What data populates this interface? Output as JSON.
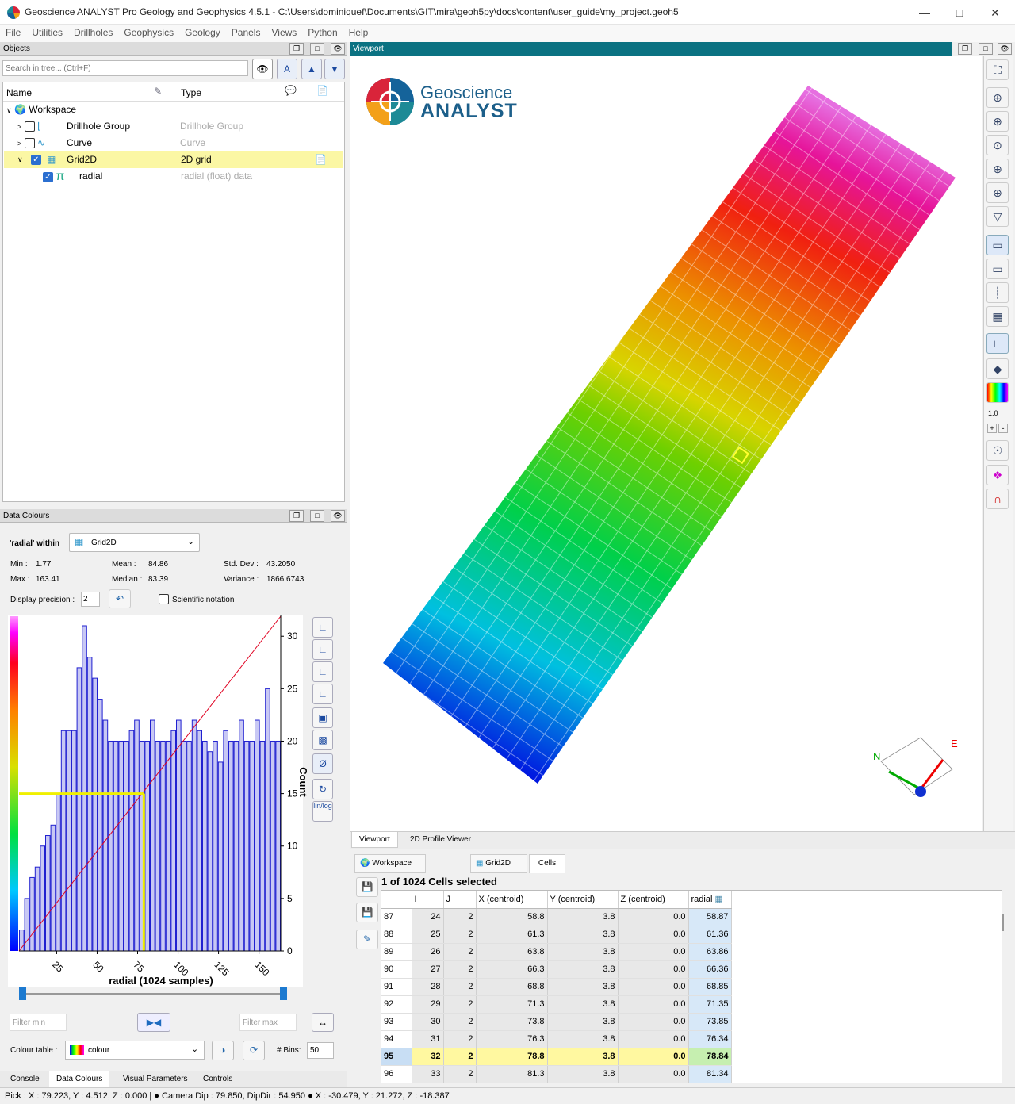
{
  "window": {
    "title": "Geoscience ANALYST Pro Geology and Geophysics 4.5.1 - C:\\Users\\dominiquef\\Documents\\GIT\\mira\\geoh5py\\docs\\content\\user_guide\\my_project.geoh5"
  },
  "menu": [
    "File",
    "Utilities",
    "Drillholes",
    "Geophysics",
    "Geology",
    "Panels",
    "Views",
    "Python",
    "Help"
  ],
  "objects_panel": {
    "header": "Objects",
    "search_placeholder": "Search in tree... (Ctrl+F)",
    "columns": {
      "name": "Name",
      "type": "Type"
    },
    "tree": [
      {
        "name": "Workspace",
        "type": ""
      },
      {
        "name": "Drillhole Group",
        "type": "Drillhole Group"
      },
      {
        "name": "Curve",
        "type": "Curve"
      },
      {
        "name": "Grid2D",
        "type": "2D grid"
      },
      {
        "name": "radial",
        "type": "radial (float) data"
      }
    ]
  },
  "viewport": {
    "header": "Viewport",
    "logo_line1": "Geoscience",
    "logo_line2": "ANALYST",
    "axis_n": "N",
    "axis_e": "E",
    "opacity_value": "1.0",
    "tabs": [
      "Viewport",
      "2D Profile Viewer"
    ]
  },
  "data_colours": {
    "header": "Data Colours",
    "within_label": "'radial' within",
    "within_value": "Grid2D",
    "stats": {
      "min_label": "Min :",
      "min": "1.77",
      "mean_label": "Mean :",
      "mean": "84.86",
      "std_label": "Std. Dev :",
      "std": "43.2050",
      "max_label": "Max :",
      "max": "163.41",
      "median_label": "Median :",
      "median": "83.39",
      "var_label": "Variance :",
      "var": "1866.6743"
    },
    "precision_label": "Display precision :",
    "precision_value": "2",
    "sci_label": "Scientific notation",
    "filter_min_placeholder": "Filter min",
    "filter_max_placeholder": "Filter max",
    "colour_table_label": "Colour table :",
    "colour_table_value": "colour",
    "bins_label": "# Bins:",
    "bins_value": "50",
    "log_btn": "lin/log"
  },
  "chart_data": {
    "type": "bar",
    "xlabel": "radial (1024 samples)",
    "ylabel": "Count",
    "xlim": [
      1.77,
      163.41
    ],
    "ylim": [
      0,
      31
    ],
    "xticks": [
      25,
      50,
      75,
      100,
      125,
      150
    ],
    "yticks": [
      0,
      5,
      10,
      15,
      20,
      25,
      30
    ],
    "values": [
      2,
      5,
      7,
      8,
      10,
      11,
      12,
      15,
      21,
      21,
      21,
      27,
      31,
      28,
      26,
      24,
      22,
      20,
      20,
      20,
      20,
      21,
      22,
      20,
      20,
      22,
      20,
      20,
      20,
      21,
      22,
      20,
      20,
      22,
      21,
      20,
      19,
      20,
      18,
      21,
      20,
      20,
      22,
      20,
      20,
      22,
      20,
      25,
      20,
      20
    ],
    "selected_value": 78.84,
    "selected_count": 15
  },
  "cells_panel": {
    "tabs": [
      "Workspace",
      "Grid2D",
      "Cells"
    ],
    "selection_text": "1 of 1024 Cells selected",
    "columns": [
      "I",
      "J",
      "X (centroid)",
      "Y (centroid)",
      "Z (centroid)",
      "radial"
    ],
    "rows": [
      [
        "87",
        "24",
        "2",
        "58.8",
        "3.8",
        "0.0",
        "58.87"
      ],
      [
        "88",
        "25",
        "2",
        "61.3",
        "3.8",
        "0.0",
        "61.36"
      ],
      [
        "89",
        "26",
        "2",
        "63.8",
        "3.8",
        "0.0",
        "63.86"
      ],
      [
        "90",
        "27",
        "2",
        "66.3",
        "3.8",
        "0.0",
        "66.36"
      ],
      [
        "91",
        "28",
        "2",
        "68.8",
        "3.8",
        "0.0",
        "68.85"
      ],
      [
        "92",
        "29",
        "2",
        "71.3",
        "3.8",
        "0.0",
        "71.35"
      ],
      [
        "93",
        "30",
        "2",
        "73.8",
        "3.8",
        "0.0",
        "73.85"
      ],
      [
        "94",
        "31",
        "2",
        "76.3",
        "3.8",
        "0.0",
        "76.34"
      ],
      [
        "95",
        "32",
        "2",
        "78.8",
        "3.8",
        "0.0",
        "78.84"
      ],
      [
        "96",
        "33",
        "2",
        "81.3",
        "3.8",
        "0.0",
        "81.34"
      ]
    ],
    "selected_row": "95"
  },
  "bottom_tabs": [
    "Console",
    "Data Colours",
    "Visual Parameters",
    "Controls"
  ],
  "status_bar": "Pick : X : 79.223, Y : 4.512, Z : 0.000 |  ●  Camera Dip : 79.850, DipDir : 54.950  ●  X : -30.479, Y : 21.272, Z : -18.387"
}
